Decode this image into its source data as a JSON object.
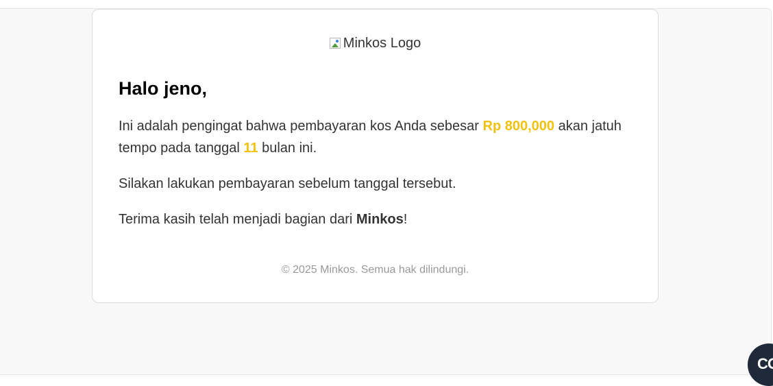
{
  "email": {
    "logo_alt": "Minkos Logo",
    "greeting": "Halo jeno,",
    "paragraph1": {
      "before_amount": "Ini adalah pengingat bahwa pembayaran kos Anda sebesar ",
      "amount": "Rp 800,000",
      "after_amount": " akan jatuh tempo pada tanggal ",
      "due_day": "11",
      "after_day": " bulan ini."
    },
    "paragraph2": "Silakan lakukan pembayaran sebelum tanggal tersebut.",
    "paragraph3": {
      "before_brand": "Terima kasih telah menjadi bagian dari ",
      "brand": "Minkos",
      "after_brand": "!"
    },
    "footer": "© 2025 Minkos. Semua hak dilindungi."
  },
  "chat_widget": {
    "label": "CO"
  },
  "colors": {
    "accent": "#f0c20f",
    "page_bg": "#f8f8f8",
    "card_bg": "#ffffff",
    "widget_bg": "#1e2a3a"
  },
  "icons": {
    "broken_image": "broken-image-icon"
  }
}
